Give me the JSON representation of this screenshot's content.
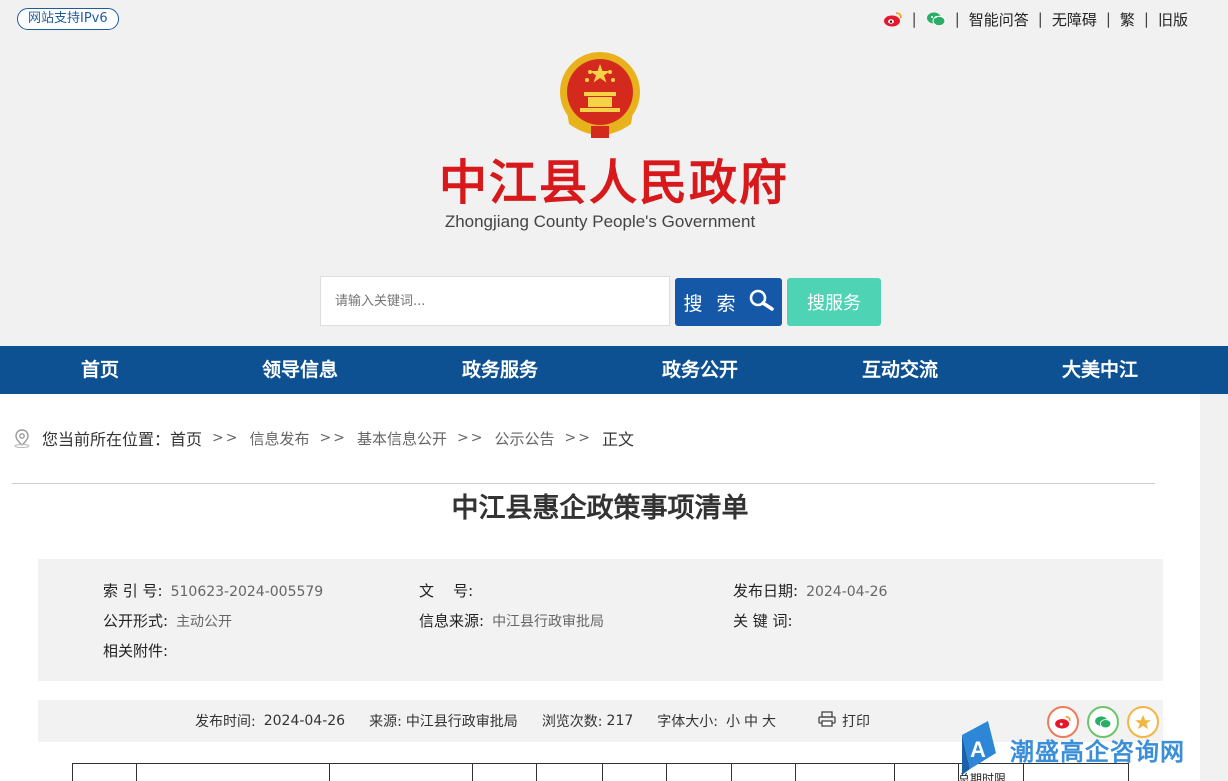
{
  "topbar": {
    "ipv6_label": "网站支持IPv6",
    "links": [
      "智能问答",
      "无障碍",
      "繁",
      "旧版"
    ],
    "social_icons": [
      "weibo-icon",
      "wechat-icon"
    ]
  },
  "header": {
    "title": "中江县人民政府",
    "subtitle": "Zhongjiang County People's Government"
  },
  "search": {
    "placeholder": "请输入关键词...",
    "button_label": "搜 索",
    "service_label": "搜服务"
  },
  "nav": {
    "items": [
      "首页",
      "领导信息",
      "政务服务",
      "政务公开",
      "互动交流",
      "大美中江"
    ]
  },
  "breadcrumb": {
    "prefix": "您当前所在位置：",
    "items": [
      "首页",
      "信息发布",
      "基本信息公开",
      "公示公告",
      "正文"
    ],
    "separator": ">>"
  },
  "article": {
    "title": "中江县惠企政策事项清单"
  },
  "meta": {
    "index_label": "索 引 号:",
    "index_value": "510623-2024-005579",
    "doc_label": "文    号:",
    "doc_value": "",
    "date_label": "发布日期:",
    "date_value": "2024-04-26",
    "form_label": "公开形式:",
    "form_value": "主动公开",
    "source_label": "信息来源:",
    "source_value": "中江县行政审批局",
    "keyword_label": "关 键 词:",
    "keyword_value": "",
    "attach_label": "相关附件:"
  },
  "infobar": {
    "time_label": "发布时间:",
    "time_value": "2024-04-26",
    "source_label": "来源:",
    "source_value": "中江县行政审批局",
    "views_label": "浏览次数:",
    "views_value": "217",
    "fontsize_label": "字体大小:",
    "font_small": "小",
    "font_mid": "中",
    "font_large": "大",
    "print_label": "打印"
  },
  "table": {
    "partial_header": "总期时限"
  },
  "watermark": {
    "text": "潮盛高企咨询网"
  },
  "colors": {
    "brand_red": "#d7191c",
    "nav_blue": "#0d5192",
    "search_blue": "#1558a8",
    "service_green": "#4fd3b5"
  }
}
